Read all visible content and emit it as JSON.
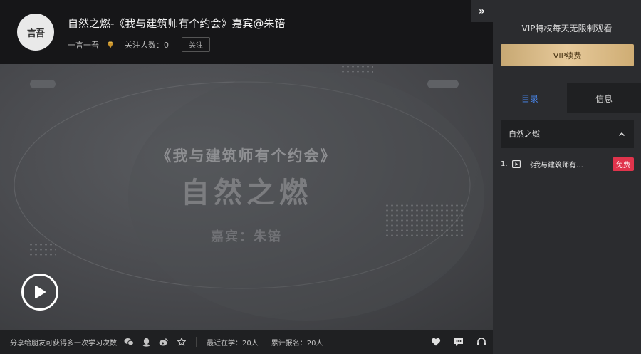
{
  "header": {
    "logo_text": "言吾",
    "title": "自然之燃-《我与建筑师有个约会》嘉宾@朱锫",
    "author": "一言一吾",
    "followers_label": "关注人数：0",
    "follow_button": "关注"
  },
  "video": {
    "slide_title": "《我与建筑师有个约会》",
    "slide_big": "自然之燃",
    "slide_guest": "嘉宾：朱锫"
  },
  "bottombar": {
    "share_text": "分享给朋友可获得多一次学习次数",
    "recent_learning": "最近在学：20人",
    "total_signup": "累计报名：20人"
  },
  "sidebar": {
    "collapse_glyph": "»",
    "vip_text": "VIP特权每天无限制观看",
    "vip_button": "VIP续费",
    "tabs": [
      {
        "label": "目录"
      },
      {
        "label": "信息"
      }
    ],
    "section_title": "自然之燃",
    "lessons": [
      {
        "num": "1.",
        "name": "《我与建筑师有个约会》",
        "badge": "免费"
      }
    ]
  },
  "colors": {
    "accent_blue": "#4a8af4",
    "vip_gold": "#d9ba86",
    "free_red": "#e0344c"
  }
}
